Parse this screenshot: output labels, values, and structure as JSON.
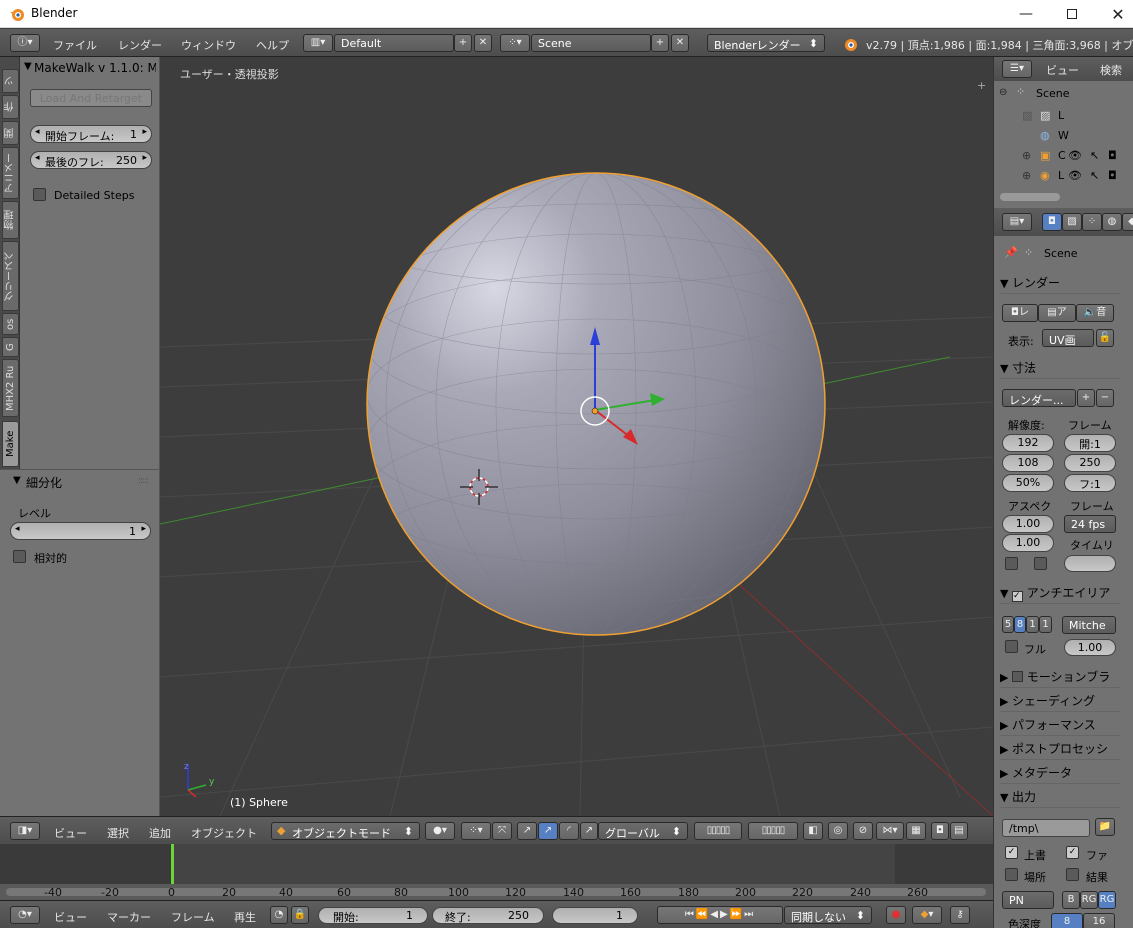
{
  "window": {
    "title": "Blender"
  },
  "info_header": {
    "menus": [
      "ファイル",
      "レンダー",
      "ウィンドウ",
      "ヘルプ"
    ],
    "screen_layout": "Default",
    "scene": "Scene",
    "render_engine": "Blenderレンダー",
    "stats": "v2.79 | 頂点:1,986 | 面:1,984 | 三角面:3,968 | オブジ"
  },
  "tool_tabs": [
    "ツ",
    "作",
    "関",
    "アニメー",
    "物理",
    "グリースペ",
    "os",
    "G",
    "MHX2 Ru",
    "Make"
  ],
  "makewalk": {
    "title": "MakeWalk v 1.1.0: M",
    "load_button": "Load And Retarget",
    "start_frame_label": "開始フレーム:",
    "start_frame_value": "1",
    "end_frame_label": "最後のフレ:",
    "end_frame_value": "250",
    "detailed_steps": "Detailed Steps"
  },
  "subdivision": {
    "title": "細分化",
    "level_label": "レベル",
    "level_value": "1",
    "relative_label": "相対的"
  },
  "viewport": {
    "view_name": "ユーザー・透視投影",
    "object_label": "(1) Sphere",
    "selected_outline": "#f0a030"
  },
  "view3d_header": {
    "menus": [
      "ビュー",
      "選択",
      "追加",
      "オブジェクト"
    ],
    "mode": "オブジェクトモード",
    "orientation": "グローバル"
  },
  "timeline": {
    "ruler": [
      "-40",
      "-20",
      "0",
      "20",
      "40",
      "60",
      "80",
      "100",
      "120",
      "140",
      "160",
      "180",
      "200",
      "220",
      "240",
      "260"
    ],
    "current_frame_color": "#6cd43a"
  },
  "timeline_header": {
    "menus": [
      "ビュー",
      "マーカー",
      "フレーム",
      "再生"
    ],
    "start_label": "開始:",
    "start_value": "1",
    "end_label": "終了:",
    "end_value": "250",
    "current": "1",
    "sync": "同期しない"
  },
  "outliner": {
    "view_label": "ビュー",
    "search_label": "検索",
    "scene_item": "Scene",
    "rows": [
      "L",
      "W",
      "C",
      "L"
    ]
  },
  "properties": {
    "context": "Scene",
    "render_section": "レンダー",
    "render_btn": "レ",
    "anim_btn": "ア",
    "audio_btn": "音",
    "display_label": "表示:",
    "display_value": "UV画",
    "dimensions_section": "寸法",
    "preset": "レンダー...",
    "resolution_label": "解像度:",
    "res_x": "192",
    "res_y": "108",
    "res_pct": "50%",
    "frame_range_label": "フレーム",
    "frame_start": "開:1",
    "frame_end": "250",
    "frame_step": "フ:1",
    "aspect_label": "アスペク",
    "aspect_x": "1.00",
    "aspect_y": "1.00",
    "framerate_label": "フレーム",
    "fps": "24 fps",
    "time_remap_label": "タイムリ",
    "aa_section": "アンチエイリア",
    "aa_samples": [
      "5",
      "8",
      "1",
      "1"
    ],
    "aa_filter": "Mitche",
    "full_label": "フル",
    "full_value": "1.00",
    "motion_blur": "モーションブラ",
    "shading": "シェーディング",
    "performance": "パフォーマンス",
    "postprocessing": "ポストプロセッシ",
    "metadata": "メタデータ",
    "output_section": "出力",
    "output_path": "/tmp\\",
    "overwrite": "上書",
    "file_ext": "ファ",
    "placeholders": "場所",
    "results": "結果",
    "format": "PN",
    "bw": "B",
    "rgb": "RG",
    "rgba": "RG",
    "color_depth_label": "色深度",
    "depth_8": "8",
    "depth_16": "16"
  }
}
